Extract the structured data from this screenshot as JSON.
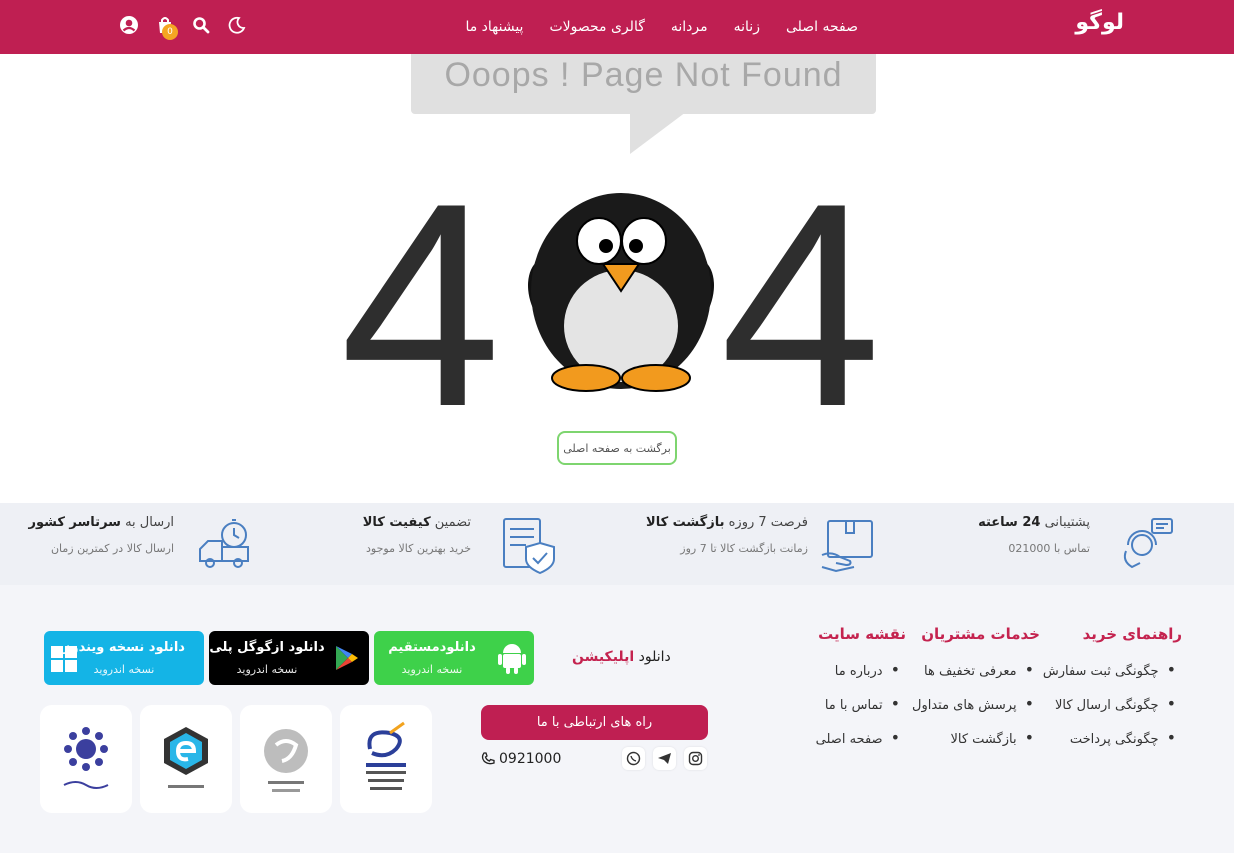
{
  "header": {
    "logo": "لوگو",
    "nav": [
      "صفحه اصلی",
      "زنانه",
      "مردانه",
      "گالری محصولات",
      "پیشنهاد ما"
    ],
    "cart_count": "0",
    "icons": [
      "user-icon",
      "cart-icon",
      "search-icon",
      "moon-icon"
    ]
  },
  "error": {
    "bubble_text": "Ooops ! Page  Not Found",
    "digit_left": "4",
    "digit_right": "4",
    "home_button": "برگشت به صفحه اصلی"
  },
  "features": [
    {
      "title_pre": "پشتیبانی ",
      "title_bold": "24 ساعته",
      "sub": "تماس با 021000",
      "icon": "support-agent-icon"
    },
    {
      "title_pre": "فرصت 7 روزه ",
      "title_bold": "بازگشت کالا",
      "sub": "زمانت بازگشت کالا تا 7 روز",
      "icon": "return-box-icon"
    },
    {
      "title_pre": "تضمین ",
      "title_bold": "کیفیت کالا",
      "sub": "خرید بهترین کالا موجود",
      "icon": "quality-certificate-icon"
    },
    {
      "title_pre": "ارسال به ",
      "title_bold": "سرتاسر کشور",
      "sub": "ارسال کالا در کمترین زمان",
      "icon": "delivery-truck-icon"
    }
  ],
  "footer": {
    "columns": [
      {
        "title": "راهنمای خرید",
        "items": [
          "چگونگی ثبت سفارش",
          "چگونگی ارسال کالا",
          "چگونگی پرداخت"
        ]
      },
      {
        "title": "خدمات مشتریان",
        "items": [
          "معرفی تخفیف ها",
          "پرسش های متداول",
          "بازگشت کالا"
        ]
      },
      {
        "title": "نقشه سایت",
        "items": [
          "درباره ما",
          "تماس با ما",
          "صفحه اصلی"
        ]
      }
    ],
    "app_label_pre": "دانلود ",
    "app_label_bold": "اپلیکیشن",
    "downloads": [
      {
        "line1": "دانلودمستقیم",
        "line2": "نسخه اندروید",
        "icon": "android-icon",
        "color": "#3ed14a"
      },
      {
        "line1_pre": "دانلود ",
        "line1_bold": "ازگوگل پلی",
        "line2": "نسخه اندروید",
        "icon": "google-play-icon",
        "color": "#000000"
      },
      {
        "line1_pre": "دانلود ",
        "line1_bold": "نسخه ویندوز",
        "line2": "نسخه اندروید",
        "icon": "windows-icon",
        "color": "#14b4e6"
      }
    ],
    "contact_button": "راه های ارتباطی با ما",
    "phone": "0921000",
    "socials": [
      "instagram-icon",
      "telegram-icon",
      "whatsapp-icon"
    ],
    "badges": [
      "enamad-badge",
      "samandehi-badge",
      "electronic-union-badge",
      "ecommerce-association-badge"
    ]
  },
  "colors": {
    "primary": "#bf1f52",
    "accent": "#c4234f",
    "band": "#eef0f5",
    "footer_bg": "#f4f5f9",
    "cart_badge": "#f5a623"
  }
}
